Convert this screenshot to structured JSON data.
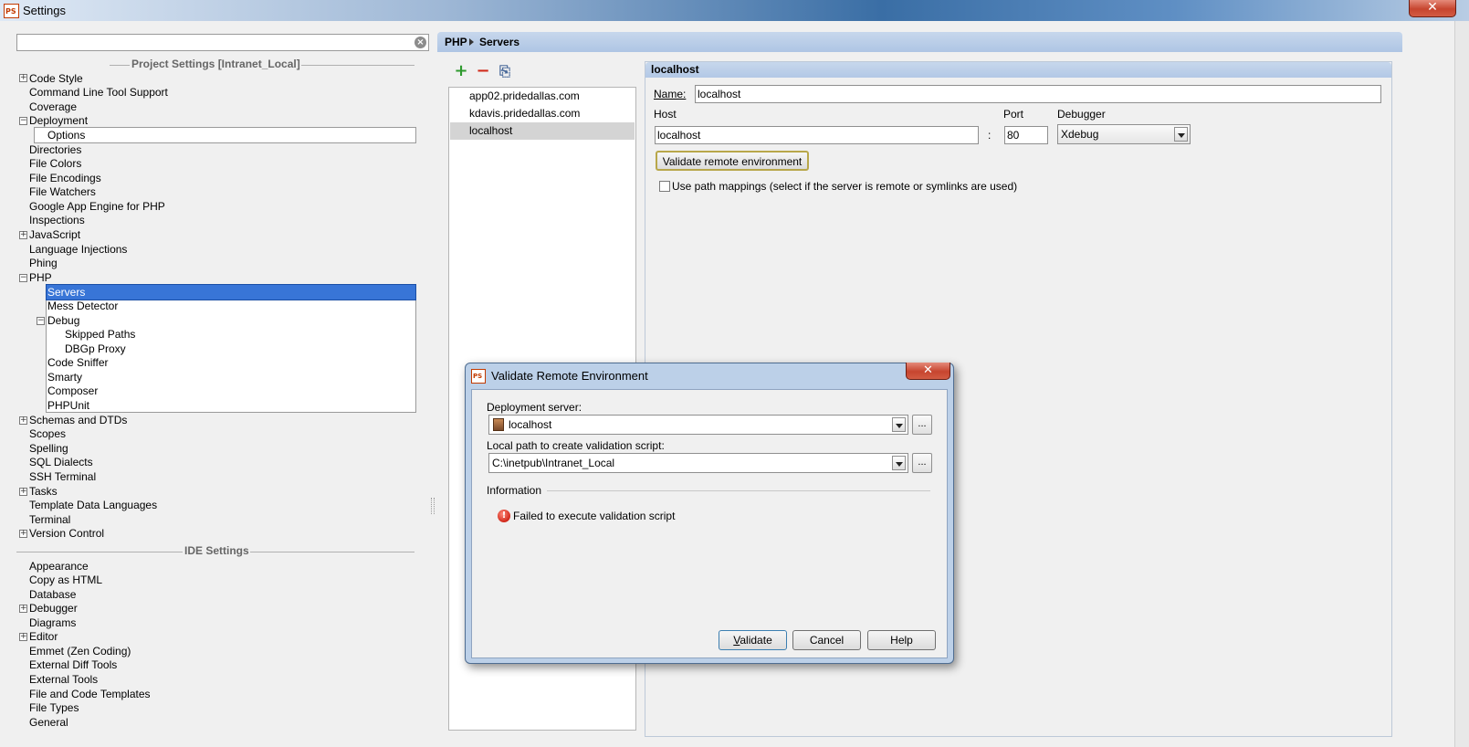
{
  "window": {
    "title": "Settings",
    "close_glyph": "✕"
  },
  "search": {
    "value": "",
    "clear_glyph": "×"
  },
  "tree": {
    "project_header": "Project Settings [Intranet_Local]",
    "ide_header": "IDE Settings",
    "items": {
      "code_style": "Code Style",
      "command_line": "Command Line Tool Support",
      "coverage": "Coverage",
      "deployment": "Deployment",
      "options": "Options",
      "directories": "Directories",
      "file_colors": "File Colors",
      "file_encodings": "File Encodings",
      "file_watchers": "File Watchers",
      "google_app_engine": "Google App Engine for PHP",
      "inspections": "Inspections",
      "javascript": "JavaScript",
      "language_injections": "Language Injections",
      "phing": "Phing",
      "php": "PHP",
      "servers": "Servers",
      "mess_detector": "Mess Detector",
      "debug": "Debug",
      "skipped_paths": "Skipped Paths",
      "dbgp_proxy": "DBGp Proxy",
      "code_sniffer": "Code Sniffer",
      "smarty": "Smarty",
      "composer": "Composer",
      "phpunit": "PHPUnit",
      "schemas_dtds": "Schemas and DTDs",
      "scopes": "Scopes",
      "spelling": "Spelling",
      "sql_dialects": "SQL Dialects",
      "ssh_terminal": "SSH Terminal",
      "tasks": "Tasks",
      "template_data_languages": "Template Data Languages",
      "terminal": "Terminal",
      "version_control": "Version Control",
      "appearance": "Appearance",
      "copy_as_html": "Copy as HTML",
      "database": "Database",
      "debugger": "Debugger",
      "diagrams": "Diagrams",
      "editor": "Editor",
      "emmet": "Emmet (Zen Coding)",
      "external_diff_tools": "External Diff Tools",
      "external_tools": "External Tools",
      "file_code_templates": "File and Code Templates",
      "file_types": "File Types",
      "general": "General"
    },
    "expand_glyph": "+",
    "collapse_glyph": "−"
  },
  "breadcrumb": {
    "parent": "PHP",
    "current": "Servers"
  },
  "toolbar": {
    "add_glyph": "+",
    "remove_glyph": "−",
    "copy_glyph": "⎘"
  },
  "servers": {
    "items": [
      "app02.pridedallas.com",
      "kdavis.pridedallas.com",
      "localhost"
    ]
  },
  "detail": {
    "header": "localhost",
    "name_label": "Name:",
    "name_value": "localhost",
    "host_label": "Host",
    "host_value": "localhost",
    "colon": ":",
    "port_label": "Port",
    "port_value": "80",
    "debugger_label": "Debugger",
    "debugger_value": "Xdebug",
    "validate_button": "Validate remote environment",
    "path_mappings_label": "Use path mappings (select if the server is remote or symlinks are used)"
  },
  "dialog": {
    "title": "Validate Remote Environment",
    "close_glyph": "✕",
    "deployment_label": "Deployment server:",
    "deployment_value": "localhost",
    "local_path_label": "Local path to create validation script:",
    "local_path_value": "C:\\inetpub\\Intranet_Local",
    "ellipsis": "...",
    "info_label": "Information",
    "error_text": "Failed to execute validation script",
    "error_glyph": "!",
    "validate": "Validate",
    "cancel": "Cancel",
    "help": "Help"
  }
}
